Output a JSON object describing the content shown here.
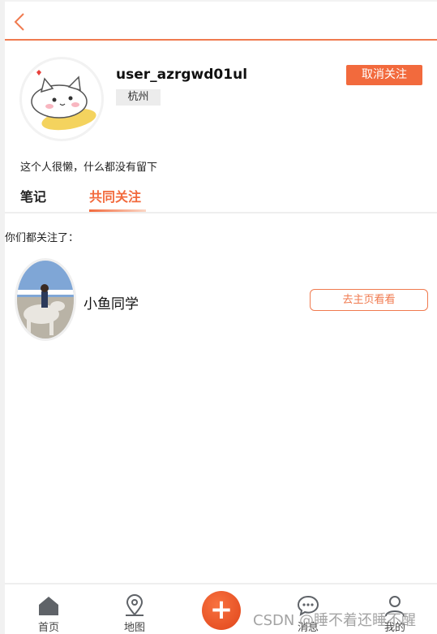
{
  "header": {
    "back_icon": "chevron-left-icon",
    "accent": "#f26a3d"
  },
  "profile": {
    "avatar_icon": "cat-avatar-icon",
    "username": "user_azrgwd01ul",
    "city": "杭州",
    "unfollow_label": "取消关注",
    "bio": "这个人很懒，什么都没有留下"
  },
  "tabs": [
    {
      "label": "笔记",
      "active": false
    },
    {
      "label": "共同关注",
      "active": true
    }
  ],
  "mutual": {
    "title": "你们都关注了：",
    "items": [
      {
        "name": "小鱼同学",
        "action_label": "去主页看看"
      }
    ]
  },
  "bottom_nav": {
    "items": [
      {
        "label": "首页",
        "icon": "home-icon"
      },
      {
        "label": "地图",
        "icon": "map-pin-icon"
      },
      {
        "label": "+",
        "icon": "plus-icon"
      },
      {
        "label": "消息",
        "icon": "chat-bubble-icon"
      },
      {
        "label": "我的",
        "icon": "user-icon"
      }
    ]
  },
  "watermark": "CSDN @睡不着还睡不醒"
}
